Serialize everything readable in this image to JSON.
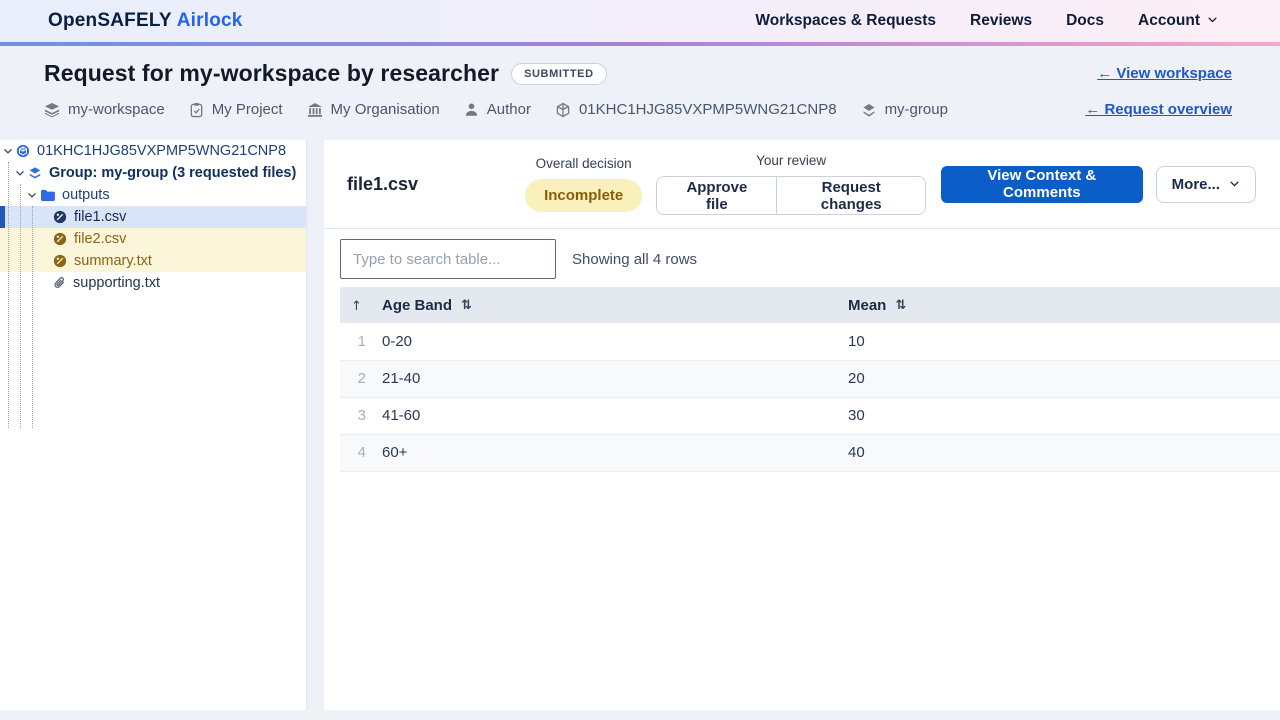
{
  "nav": {
    "brand_primary": "OpenSAFELY",
    "brand_secondary": "Airlock",
    "items": [
      {
        "label": "Workspaces & Requests"
      },
      {
        "label": "Reviews"
      },
      {
        "label": "Docs"
      },
      {
        "label": "Account"
      }
    ]
  },
  "header": {
    "title": "Request for my-workspace by researcher",
    "status_badge": "SUBMITTED",
    "links": {
      "view_workspace": "← View workspace",
      "request_overview": "← Request overview"
    },
    "meta": [
      {
        "icon": "workspace-layers-icon",
        "label": "my-workspace"
      },
      {
        "icon": "project-clipboard-icon",
        "label": "My Project"
      },
      {
        "icon": "organisation-bank-icon",
        "label": "My Organisation"
      },
      {
        "icon": "author-user-icon",
        "label": "Author"
      },
      {
        "icon": "request-id-cube-icon",
        "label": "01KHC1HJG85VXPMP5WNG21CNP8"
      },
      {
        "icon": "group-layers-icon",
        "label": "my-group"
      }
    ]
  },
  "sidebar": {
    "tree": [
      {
        "label": "01KHC1HJG85VXPMP5WNG21CNP8",
        "depth": 0,
        "icon": "request-cube-icon",
        "expanded": true
      },
      {
        "label": "Group: my-group (3 requested files)",
        "depth": 1,
        "icon": "group-layers-icon",
        "expanded": true
      },
      {
        "label": "outputs",
        "depth": 2,
        "icon": "folder-icon",
        "expanded": true
      },
      {
        "label": "file1.csv",
        "depth": 3,
        "icon": "output-file-icon",
        "state": "selected"
      },
      {
        "label": "file2.csv",
        "depth": 3,
        "icon": "output-file-icon",
        "state": "highlighted"
      },
      {
        "label": "summary.txt",
        "depth": 3,
        "icon": "output-file-icon",
        "state": "highlighted"
      },
      {
        "label": "supporting.txt",
        "depth": 3,
        "icon": "paperclip-icon",
        "state": "default"
      }
    ]
  },
  "main": {
    "file_title": "file1.csv",
    "overall_decision_label": "Overall decision",
    "decision_badge": "Incomplete",
    "your_review_label": "Your review",
    "approve_button": "Approve file",
    "request_changes_button": "Request changes",
    "context_button": "View Context & Comments",
    "more_button": "More...",
    "search_placeholder": "Type to search table...",
    "search_value": "",
    "row_count_text": "Showing all 4 rows"
  },
  "table": {
    "sort_asc_icon": "↑",
    "sort_both_icon": "⇅",
    "columns": [
      "Age Band",
      "Mean"
    ],
    "rows": [
      {
        "index": "1",
        "age_band": "0-20",
        "mean": "10"
      },
      {
        "index": "2",
        "age_band": "21-40",
        "mean": "20"
      },
      {
        "index": "3",
        "age_band": "41-60",
        "mean": "30"
      },
      {
        "index": "4",
        "age_band": "60+",
        "mean": "40"
      }
    ]
  },
  "colors": {
    "accent_blue": "#0b5dc7",
    "link_blue": "#2158c9",
    "brand_navy": "#0a1e3f",
    "decision_badge_bg": "#faf0bb",
    "decision_badge_text": "#8a5c0a",
    "selected_row_bg": "#d9e5f7",
    "changes_row_bg": "#fbf5da",
    "gradient": [
      "#6e93e0",
      "#a583d8",
      "#f6a8c8"
    ]
  }
}
